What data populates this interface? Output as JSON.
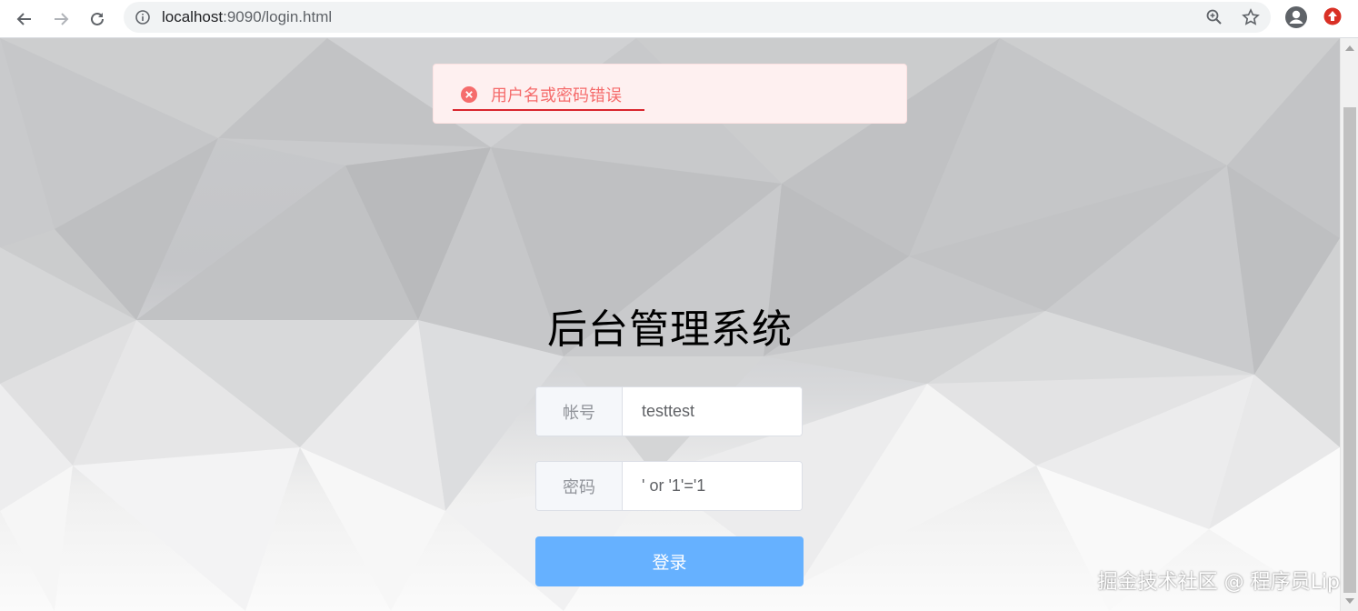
{
  "browser": {
    "url_host": "localhost",
    "url_rest": ":9090/login.html",
    "icons": [
      "back-arrow-icon",
      "forward-arrow-icon",
      "reload-icon",
      "info-icon",
      "zoom-icon",
      "star-icon",
      "account-icon",
      "extension-icon"
    ]
  },
  "message": {
    "text": "用户名或密码错误",
    "type": "error",
    "color": "#f56c6c"
  },
  "login": {
    "title": "后台管理系统",
    "username_label": "帐号",
    "username_value": "testtest",
    "password_label": "密码",
    "password_value": "' or '1'='1",
    "submit_label": "登录",
    "button_color": "#66b1ff"
  },
  "watermark": "掘金技术社区 @ 程序员Lip"
}
